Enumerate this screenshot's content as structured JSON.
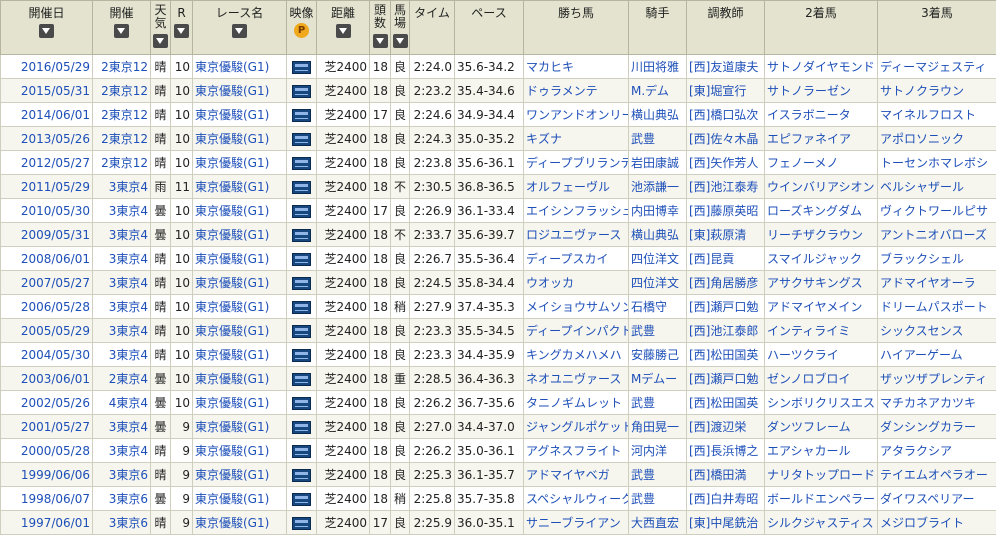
{
  "headers": {
    "date": "開催日",
    "venue": "開催",
    "weather_1": "天",
    "weather_2": "気",
    "race_no": "R",
    "race_name": "レース名",
    "video": "映像",
    "distance": "距離",
    "runners_1": "頭",
    "runners_2": "数",
    "going_1": "馬",
    "going_2": "場",
    "time": "タイム",
    "pace": "ペース",
    "winner": "勝ち馬",
    "jockey": "騎手",
    "trainer": "調教師",
    "second": "2着馬",
    "third": "3着馬"
  },
  "video_premium_icon": "P",
  "icons": {
    "sort": "chevron-down-icon",
    "video": "video-icon",
    "premium": "premium-icon"
  },
  "rows": [
    {
      "date": "2016/05/29",
      "venue": "2東京12",
      "weather": "晴",
      "race_no": "10",
      "race_name": "東京優駿(G1)",
      "distance": "芝2400",
      "runners": "18",
      "going": "良",
      "time": "2:24.0",
      "pace": "35.6-34.2",
      "winner": "マカヒキ",
      "jockey": "川田将雅",
      "trainer": "[西]友道康夫",
      "second": "サトノダイヤモンド",
      "third": "ディーマジェスティ"
    },
    {
      "date": "2015/05/31",
      "venue": "2東京12",
      "weather": "晴",
      "race_no": "10",
      "race_name": "東京優駿(G1)",
      "distance": "芝2400",
      "runners": "18",
      "going": "良",
      "time": "2:23.2",
      "pace": "35.4-34.6",
      "winner": "ドゥラメンテ",
      "jockey": "M.デム",
      "trainer": "[東]堀宣行",
      "second": "サトノラーゼン",
      "third": "サトノクラウン"
    },
    {
      "date": "2014/06/01",
      "venue": "2東京12",
      "weather": "晴",
      "race_no": "10",
      "race_name": "東京優駿(G1)",
      "distance": "芝2400",
      "runners": "17",
      "going": "良",
      "time": "2:24.6",
      "pace": "34.9-34.4",
      "winner": "ワンアンドオンリー",
      "jockey": "横山典弘",
      "trainer": "[西]橋口弘次",
      "second": "イスラボニータ",
      "third": "マイネルフロスト"
    },
    {
      "date": "2013/05/26",
      "venue": "2東京12",
      "weather": "晴",
      "race_no": "10",
      "race_name": "東京優駿(G1)",
      "distance": "芝2400",
      "runners": "18",
      "going": "良",
      "time": "2:24.3",
      "pace": "35.0-35.2",
      "winner": "キズナ",
      "jockey": "武豊",
      "trainer": "[西]佐々木晶",
      "second": "エピファネイア",
      "third": "アポロソニック"
    },
    {
      "date": "2012/05/27",
      "venue": "2東京12",
      "weather": "晴",
      "race_no": "10",
      "race_name": "東京優駿(G1)",
      "distance": "芝2400",
      "runners": "18",
      "going": "良",
      "time": "2:23.8",
      "pace": "35.6-36.1",
      "winner": "ディープブリランテ",
      "jockey": "岩田康誠",
      "trainer": "[西]矢作芳人",
      "second": "フェノーメノ",
      "third": "トーセンホマレボシ"
    },
    {
      "date": "2011/05/29",
      "venue": "3東京4",
      "weather": "雨",
      "race_no": "11",
      "race_name": "東京優駿(G1)",
      "distance": "芝2400",
      "runners": "18",
      "going": "不",
      "time": "2:30.5",
      "pace": "36.8-36.5",
      "winner": "オルフェーヴル",
      "jockey": "池添謙一",
      "trainer": "[西]池江泰寿",
      "second": "ウインバリアシオン",
      "third": "ベルシャザール"
    },
    {
      "date": "2010/05/30",
      "venue": "3東京4",
      "weather": "曇",
      "race_no": "10",
      "race_name": "東京優駿(G1)",
      "distance": "芝2400",
      "runners": "17",
      "going": "良",
      "time": "2:26.9",
      "pace": "36.1-33.4",
      "winner": "エイシンフラッシュ",
      "jockey": "内田博幸",
      "trainer": "[西]藤原英昭",
      "second": "ローズキングダム",
      "third": "ヴィクトワールピサ"
    },
    {
      "date": "2009/05/31",
      "venue": "3東京4",
      "weather": "曇",
      "race_no": "10",
      "race_name": "東京優駿(G1)",
      "distance": "芝2400",
      "runners": "18",
      "going": "不",
      "time": "2:33.7",
      "pace": "35.6-39.7",
      "winner": "ロジユニヴァース",
      "jockey": "横山典弘",
      "trainer": "[東]萩原清",
      "second": "リーチザクラウン",
      "third": "アントニオバローズ"
    },
    {
      "date": "2008/06/01",
      "venue": "3東京4",
      "weather": "晴",
      "race_no": "10",
      "race_name": "東京優駿(G1)",
      "distance": "芝2400",
      "runners": "18",
      "going": "良",
      "time": "2:26.7",
      "pace": "35.5-36.4",
      "winner": "ディープスカイ",
      "jockey": "四位洋文",
      "trainer": "[西]昆貢",
      "second": "スマイルジャック",
      "third": "ブラックシェル"
    },
    {
      "date": "2007/05/27",
      "venue": "3東京4",
      "weather": "晴",
      "race_no": "10",
      "race_name": "東京優駿(G1)",
      "distance": "芝2400",
      "runners": "18",
      "going": "良",
      "time": "2:24.5",
      "pace": "35.8-34.4",
      "winner": "ウオッカ",
      "jockey": "四位洋文",
      "trainer": "[西]角居勝彦",
      "second": "アサクサキングス",
      "third": "アドマイヤオーラ"
    },
    {
      "date": "2006/05/28",
      "venue": "3東京4",
      "weather": "晴",
      "race_no": "10",
      "race_name": "東京優駿(G1)",
      "distance": "芝2400",
      "runners": "18",
      "going": "稍",
      "time": "2:27.9",
      "pace": "37.4-35.3",
      "winner": "メイショウサムソン",
      "jockey": "石橋守",
      "trainer": "[西]瀬戸口勉",
      "second": "アドマイヤメイン",
      "third": "ドリームパスポート"
    },
    {
      "date": "2005/05/29",
      "venue": "3東京4",
      "weather": "晴",
      "race_no": "10",
      "race_name": "東京優駿(G1)",
      "distance": "芝2400",
      "runners": "18",
      "going": "良",
      "time": "2:23.3",
      "pace": "35.5-34.5",
      "winner": "ディープインパクト",
      "jockey": "武豊",
      "trainer": "[西]池江泰郎",
      "second": "インティライミ",
      "third": "シックスセンス"
    },
    {
      "date": "2004/05/30",
      "venue": "3東京4",
      "weather": "晴",
      "race_no": "10",
      "race_name": "東京優駿(G1)",
      "distance": "芝2400",
      "runners": "18",
      "going": "良",
      "time": "2:23.3",
      "pace": "34.4-35.9",
      "winner": "キングカメハメハ",
      "jockey": "安藤勝己",
      "trainer": "[西]松田国英",
      "second": "ハーツクライ",
      "third": "ハイアーゲーム"
    },
    {
      "date": "2003/06/01",
      "venue": "2東京4",
      "weather": "曇",
      "race_no": "10",
      "race_name": "東京優駿(G1)",
      "distance": "芝2400",
      "runners": "18",
      "going": "重",
      "time": "2:28.5",
      "pace": "36.4-36.3",
      "winner": "ネオユニヴァース",
      "jockey": "Mデムー",
      "trainer": "[西]瀬戸口勉",
      "second": "ゼンノロブロイ",
      "third": "ザッツザプレンティ"
    },
    {
      "date": "2002/05/26",
      "venue": "4東京4",
      "weather": "曇",
      "race_no": "10",
      "race_name": "東京優駿(G1)",
      "distance": "芝2400",
      "runners": "18",
      "going": "良",
      "time": "2:26.2",
      "pace": "36.7-35.6",
      "winner": "タニノギムレット",
      "jockey": "武豊",
      "trainer": "[西]松田国英",
      "second": "シンボリクリスエス",
      "third": "マチカネアカツキ"
    },
    {
      "date": "2001/05/27",
      "venue": "3東京4",
      "weather": "曇",
      "race_no": "9",
      "race_name": "東京優駿(G1)",
      "distance": "芝2400",
      "runners": "18",
      "going": "良",
      "time": "2:27.0",
      "pace": "34.4-37.0",
      "winner": "ジャングルポケット",
      "jockey": "角田晃一",
      "trainer": "[西]渡辺栄",
      "second": "ダンツフレーム",
      "third": "ダンシングカラー"
    },
    {
      "date": "2000/05/28",
      "venue": "3東京4",
      "weather": "晴",
      "race_no": "9",
      "race_name": "東京優駿(G1)",
      "distance": "芝2400",
      "runners": "18",
      "going": "良",
      "time": "2:26.2",
      "pace": "35.0-36.1",
      "winner": "アグネスフライト",
      "jockey": "河内洋",
      "trainer": "[西]長浜博之",
      "second": "エアシャカール",
      "third": "アタラクシア"
    },
    {
      "date": "1999/06/06",
      "venue": "3東京6",
      "weather": "晴",
      "race_no": "9",
      "race_name": "東京優駿(G1)",
      "distance": "芝2400",
      "runners": "18",
      "going": "良",
      "time": "2:25.3",
      "pace": "36.1-35.7",
      "winner": "アドマイヤベガ",
      "jockey": "武豊",
      "trainer": "[西]橋田満",
      "second": "ナリタトップロード",
      "third": "テイエムオペラオー"
    },
    {
      "date": "1998/06/07",
      "venue": "3東京6",
      "weather": "曇",
      "race_no": "9",
      "race_name": "東京優駿(G1)",
      "distance": "芝2400",
      "runners": "18",
      "going": "稍",
      "time": "2:25.8",
      "pace": "35.7-35.8",
      "winner": "スペシャルウィーク",
      "jockey": "武豊",
      "trainer": "[西]白井寿昭",
      "second": "ボールドエンペラー",
      "third": "ダイワスペリアー"
    },
    {
      "date": "1997/06/01",
      "venue": "3東京6",
      "weather": "晴",
      "race_no": "9",
      "race_name": "東京優駿(G1)",
      "distance": "芝2400",
      "runners": "17",
      "going": "良",
      "time": "2:25.9",
      "pace": "36.0-35.1",
      "winner": "サニーブライアン",
      "jockey": "大西直宏",
      "trainer": "[東]中尾銑治",
      "second": "シルクジャスティス",
      "third": "メジロブライト"
    }
  ]
}
